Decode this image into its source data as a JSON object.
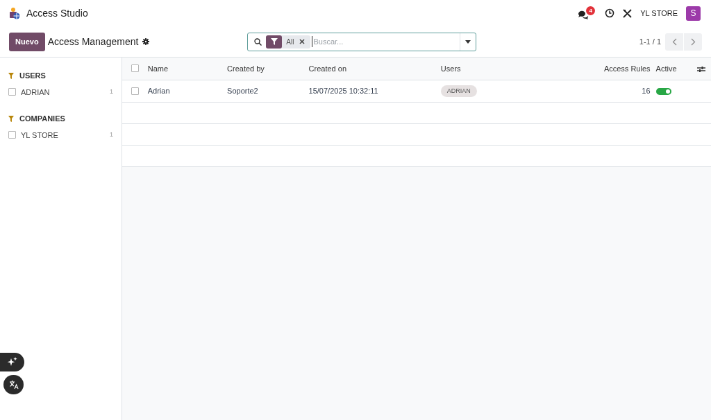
{
  "app": {
    "title": "Access Studio"
  },
  "systray": {
    "messages_count": "4",
    "company": "YL STORE",
    "avatar_letter": "S"
  },
  "control_panel": {
    "new_button": "Nuevo",
    "breadcrumb": "Access Management",
    "search": {
      "facet": "All",
      "placeholder": "Buscar..."
    },
    "pager": "1-1 / 1"
  },
  "sidebar": [
    {
      "title": "USERS",
      "items": [
        {
          "label": "ADRIAN",
          "count": "1",
          "checked": false
        }
      ]
    },
    {
      "title": "COMPANIES",
      "items": [
        {
          "label": "YL STORE",
          "count": "1",
          "checked": false
        }
      ]
    }
  ],
  "table": {
    "select_all_checked": false,
    "columns": [
      "Name",
      "Created by",
      "Created on",
      "Users",
      "Access Rules",
      "Active"
    ],
    "rows": [
      {
        "name": "Adrian",
        "created_by": "Soporte2",
        "created_on": "15/07/2025 10:32:11",
        "users": [
          "ADRIAN"
        ],
        "access_rules": "16",
        "active": true,
        "selected": false
      }
    ]
  }
}
